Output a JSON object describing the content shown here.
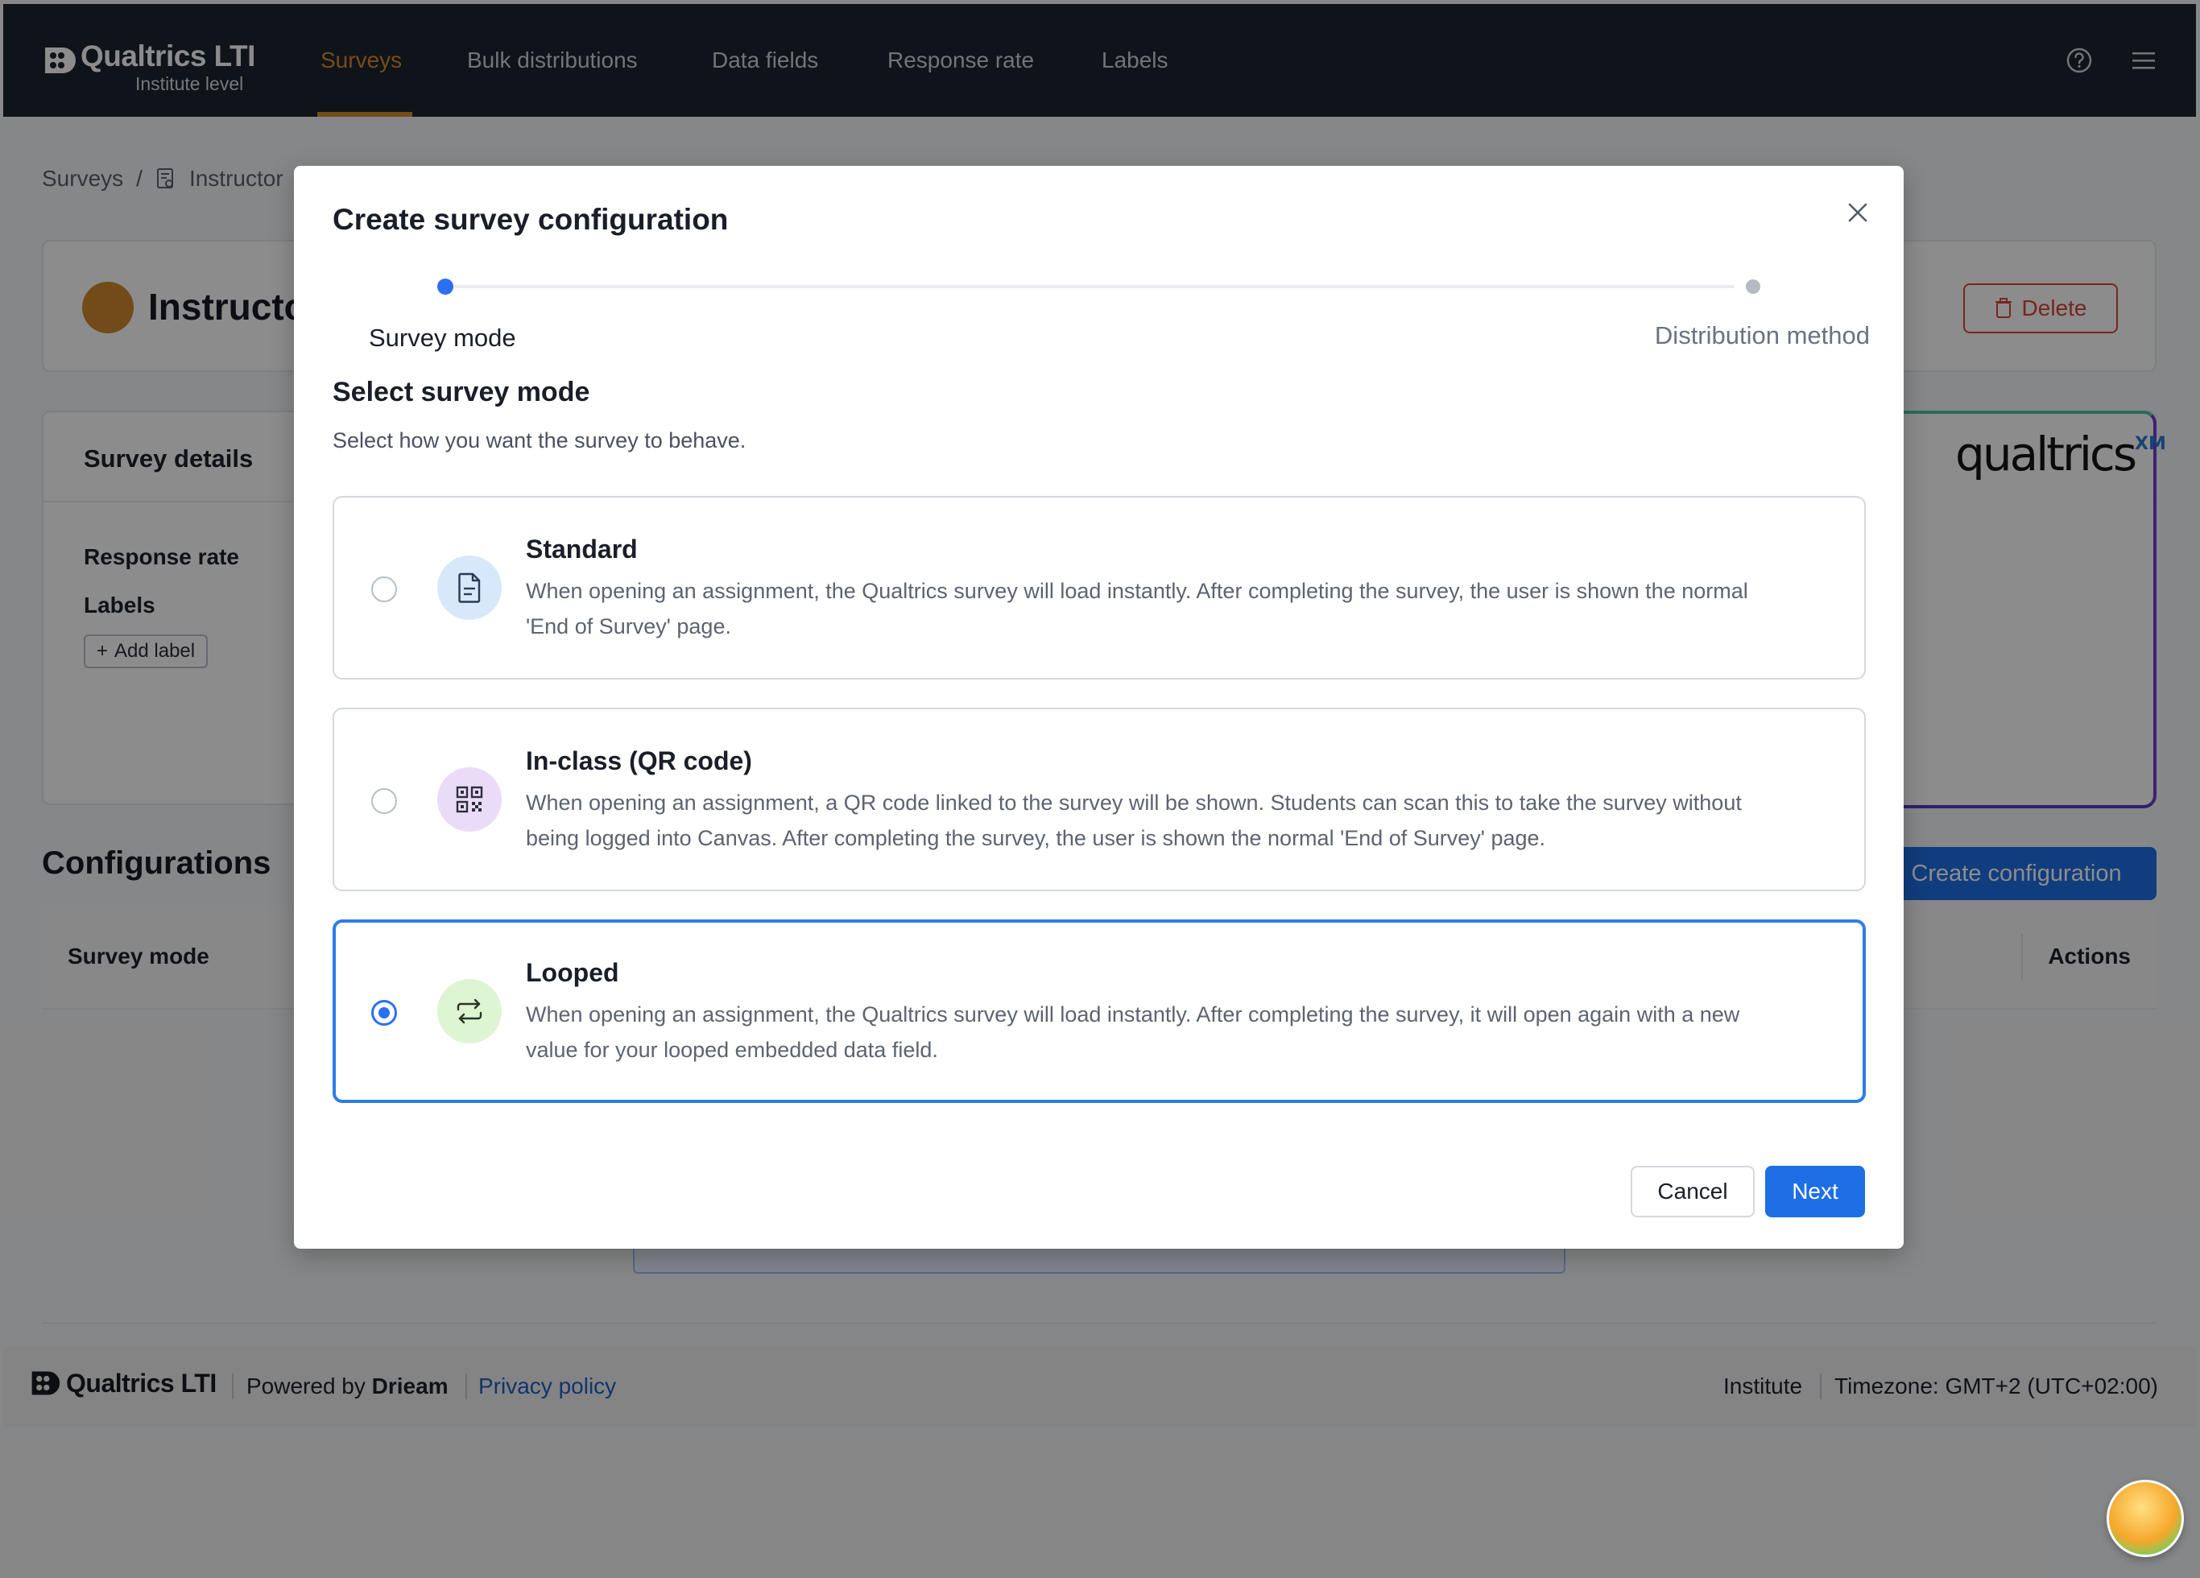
{
  "topnav": {
    "brand_name": "Qualtrics LTI",
    "brand_sub": "Institute level",
    "items": [
      {
        "label": "Surveys",
        "active": true
      },
      {
        "label": "Bulk distributions",
        "active": false
      },
      {
        "label": "Data fields",
        "active": false
      },
      {
        "label": "Response rate",
        "active": false
      },
      {
        "label": "Labels",
        "active": false
      }
    ],
    "help_icon": "help-circle-icon",
    "menu_icon": "hamburger-menu-icon",
    "accent_color": "#d9892c",
    "background_color": "#1d2330"
  },
  "breadcrumb": {
    "root": "Surveys",
    "separator": "/",
    "current": "Instructor"
  },
  "survey_header": {
    "title": "Instructo",
    "delete_label": "Delete"
  },
  "details": {
    "title": "Survey details",
    "response_rate_label": "Response rate",
    "labels_label": "Labels",
    "add_label": "Add label",
    "partner_logo_text": "qualtrics",
    "partner_logo_suffix": "XM"
  },
  "configurations": {
    "title": "Configurations",
    "create_label": "Create configuration",
    "col_survey_mode": "Survey mode",
    "col_actions": "Actions"
  },
  "footer": {
    "brand_name": "Qualtrics LTI",
    "powered_prefix": "Powered by",
    "powered_company": "Drieam",
    "privacy_link": "Privacy policy",
    "institute": "Institute",
    "timezone": "Timezone: GMT+2 (UTC+02:00)"
  },
  "modal": {
    "title": "Create survey configuration",
    "steps": [
      {
        "label": "Survey mode",
        "active": true
      },
      {
        "label": "Distribution method",
        "active": false
      }
    ],
    "section_title": "Select survey mode",
    "section_sub": "Select how you want the survey to behave.",
    "options": [
      {
        "title": "Standard",
        "description": "When opening an assignment, the Qualtrics survey will load instantly. After completing the survey, the user is shown the normal 'End of Survey' page.",
        "icon": "document-icon",
        "selected": false
      },
      {
        "title": "In-class (QR code)",
        "description": "When opening an assignment, a QR code linked to the survey will be shown. Students can scan this to take the survey without being logged into Canvas. After completing the survey, the user is shown the normal 'End of Survey' page.",
        "icon": "qr-code-icon",
        "selected": false
      },
      {
        "title": "Looped",
        "description": "When opening an assignment, the Qualtrics survey will load instantly. After completing the survey, it will open again with a new value for your looped embedded data field.",
        "icon": "repeat-icon",
        "selected": true
      }
    ],
    "cancel_label": "Cancel",
    "next_label": "Next",
    "primary_color": "#1e6fe6"
  }
}
